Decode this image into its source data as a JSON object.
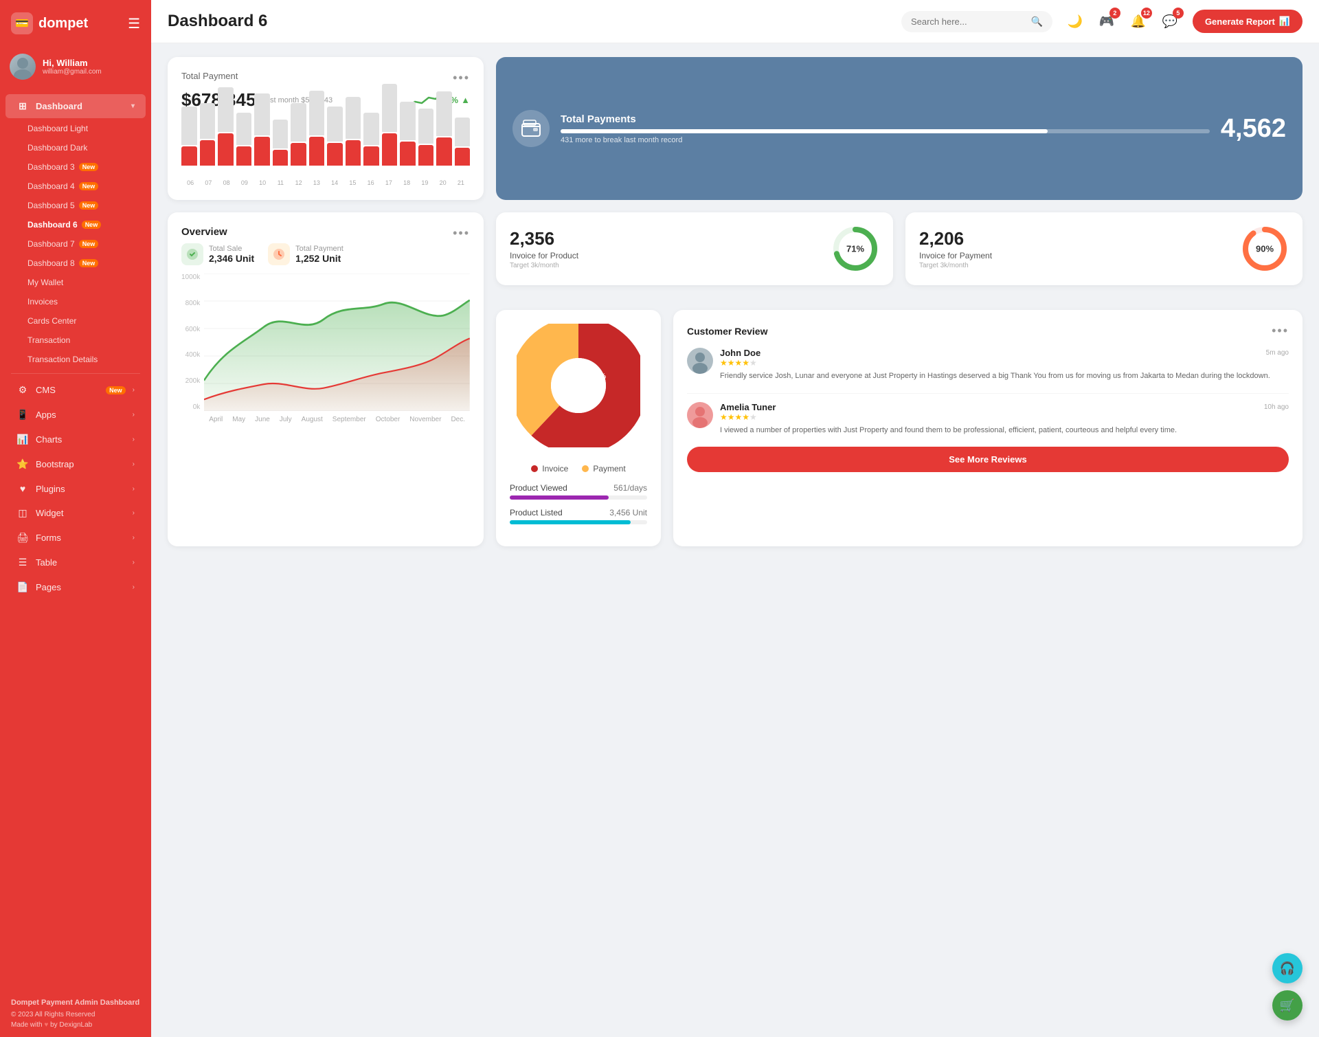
{
  "app": {
    "name": "dompet",
    "logo_symbol": "💳"
  },
  "user": {
    "greeting": "Hi, William",
    "email": "william@gmail.com",
    "avatar_emoji": "👤"
  },
  "topbar": {
    "page_title": "Dashboard 6",
    "search_placeholder": "Search here...",
    "generate_btn_label": "Generate Report",
    "badges": {
      "controller": "2",
      "bell": "12",
      "chat": "5"
    }
  },
  "sidebar": {
    "dashboard_menu": "Dashboard",
    "sub_items": [
      {
        "label": "Dashboard Light",
        "badge": ""
      },
      {
        "label": "Dashboard Dark",
        "badge": ""
      },
      {
        "label": "Dashboard 3",
        "badge": "New"
      },
      {
        "label": "Dashboard 4",
        "badge": "New"
      },
      {
        "label": "Dashboard 5",
        "badge": "New"
      },
      {
        "label": "Dashboard 6",
        "badge": "New",
        "active": true
      },
      {
        "label": "Dashboard 7",
        "badge": "New"
      },
      {
        "label": "Dashboard 8",
        "badge": "New"
      },
      {
        "label": "My Wallet",
        "badge": ""
      },
      {
        "label": "Invoices",
        "badge": ""
      },
      {
        "label": "Cards Center",
        "badge": ""
      },
      {
        "label": "Transaction",
        "badge": ""
      },
      {
        "label": "Transaction Details",
        "badge": ""
      }
    ],
    "nav_items": [
      {
        "label": "CMS",
        "badge": "New",
        "icon": "⚙️"
      },
      {
        "label": "Apps",
        "badge": "",
        "icon": "📱"
      },
      {
        "label": "Charts",
        "badge": "",
        "icon": "📊"
      },
      {
        "label": "Bootstrap",
        "badge": "",
        "icon": "⭐"
      },
      {
        "label": "Plugins",
        "badge": "",
        "icon": "❤️"
      },
      {
        "label": "Widget",
        "badge": "",
        "icon": "🔲"
      },
      {
        "label": "Forms",
        "badge": "",
        "icon": "🖨️"
      },
      {
        "label": "Table",
        "badge": "",
        "icon": "☰"
      },
      {
        "label": "Pages",
        "badge": "",
        "icon": "📄"
      }
    ]
  },
  "total_payment": {
    "title": "Total Payment",
    "value": "$678,345",
    "last_month_label": "last month $563,443",
    "trend_pct": "7%",
    "bars": {
      "labels": [
        "06",
        "07",
        "08",
        "09",
        "10",
        "11",
        "12",
        "13",
        "14",
        "15",
        "16",
        "17",
        "18",
        "19",
        "20",
        "21"
      ],
      "gray_heights": [
        60,
        55,
        70,
        50,
        65,
        45,
        60,
        70,
        55,
        65,
        50,
        75,
        60,
        55,
        70,
        45
      ],
      "red_heights": [
        30,
        40,
        50,
        30,
        45,
        25,
        35,
        45,
        35,
        40,
        30,
        50,
        38,
        32,
        44,
        28
      ]
    }
  },
  "total_payments_blue": {
    "title": "Total Payments",
    "sub": "431 more to break last month record",
    "value": "4,562",
    "progress_pct": 75
  },
  "invoice_product": {
    "value": "2,356",
    "label": "Invoice for Product",
    "target": "Target 3k/month",
    "pct": 71,
    "color": "#4caf50"
  },
  "invoice_payment": {
    "value": "2,206",
    "label": "Invoice for Payment",
    "target": "Target 3k/month",
    "pct": 90,
    "color": "#ff7043"
  },
  "overview": {
    "title": "Overview",
    "total_sale_label": "Total Sale",
    "total_sale_value": "2,346 Unit",
    "total_payment_label": "Total Payment",
    "total_payment_value": "1,252 Unit",
    "chart_labels_y": [
      "1000k",
      "800k",
      "600k",
      "400k",
      "200k",
      "0k"
    ],
    "chart_labels_x": [
      "April",
      "May",
      "June",
      "July",
      "August",
      "September",
      "October",
      "November",
      "Dec."
    ]
  },
  "pie_chart": {
    "invoice_pct": 62,
    "payment_pct": 38,
    "invoice_label": "Invoice",
    "payment_label": "Payment",
    "invoice_color": "#c62828",
    "payment_color": "#ffb74d"
  },
  "product_stats": {
    "viewed_label": "Product Viewed",
    "viewed_value": "561/days",
    "viewed_color": "#9c27b0",
    "listed_label": "Product Listed",
    "listed_value": "3,456 Unit",
    "listed_color": "#00bcd4"
  },
  "customer_review": {
    "title": "Customer Review",
    "reviews": [
      {
        "name": "John Doe",
        "time": "5m ago",
        "stars": 4,
        "text": "Friendly service Josh, Lunar and everyone at Just Property in Hastings deserved a big Thank You from us for moving us from Jakarta to Medan during the lockdown.",
        "avatar_bg": "#b0bec5"
      },
      {
        "name": "Amelia Tuner",
        "time": "10h ago",
        "stars": 4,
        "text": "I viewed a number of properties with Just Property and found them to be professional, efficient, patient, courteous and helpful every time.",
        "avatar_bg": "#ef9a9a"
      }
    ],
    "see_more_btn": "See More Reviews"
  },
  "footer": {
    "title": "Dompet Payment Admin Dashboard",
    "copy": "© 2023 All Rights Reserved",
    "made_with": "Made with",
    "made_by": "by DexignLab"
  }
}
